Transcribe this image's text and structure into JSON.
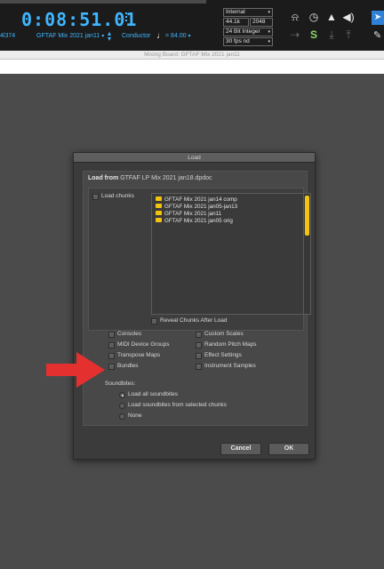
{
  "transport": {
    "counter": "0:08:51.01",
    "counter_suffix": "",
    "track_label": "4l374",
    "chunk_name": "GFTAF Mix 2021 jan11",
    "conductor_label": "Conductor",
    "tempo": "84.00",
    "sync_source": "Internal",
    "sample_rate": "44.1k",
    "buffer": "2048",
    "bit_depth": "24 Bit Integer",
    "frame_rate": "30 fps nd",
    "accent_color": "#3fb6ff"
  },
  "window": {
    "title": "Mixing Board: GFTAF Mix 2021 jan11"
  },
  "dialog": {
    "title": "Load",
    "load_from_label": "Load from",
    "load_from_file": "GTFAF LP Mix 2021 jan18.dpdoc",
    "load_chunks_label": "Load chunks",
    "chunks": [
      "GFTAF Mix 2021 jan14 comp",
      "GFTAF Mix 2021 jan05-jan13",
      "GFTAF Mix 2021 jan11",
      "GFTAF Mix 2021 jan05 orig"
    ],
    "reveal_label": "Reveal Chunks After Load",
    "options_left": [
      "Consoles",
      "MIDI Device Groups",
      "Transpose Maps",
      "Bundles"
    ],
    "options_right": [
      "Custom Scales",
      "Random Pitch Maps",
      "Effect Settings",
      "Instrument Samples"
    ],
    "soundbites_title": "Soundbites:",
    "soundbites_options": [
      "Load all soundbites",
      "Load soundbites from selected chunks",
      "None"
    ],
    "soundbites_selected": "Load all soundbites",
    "cancel_label": "Cancel",
    "ok_label": "OK",
    "folder_color": "#f2c40f"
  },
  "annotation": {
    "arrow_color": "#e53030",
    "points_to": "Bundles"
  }
}
